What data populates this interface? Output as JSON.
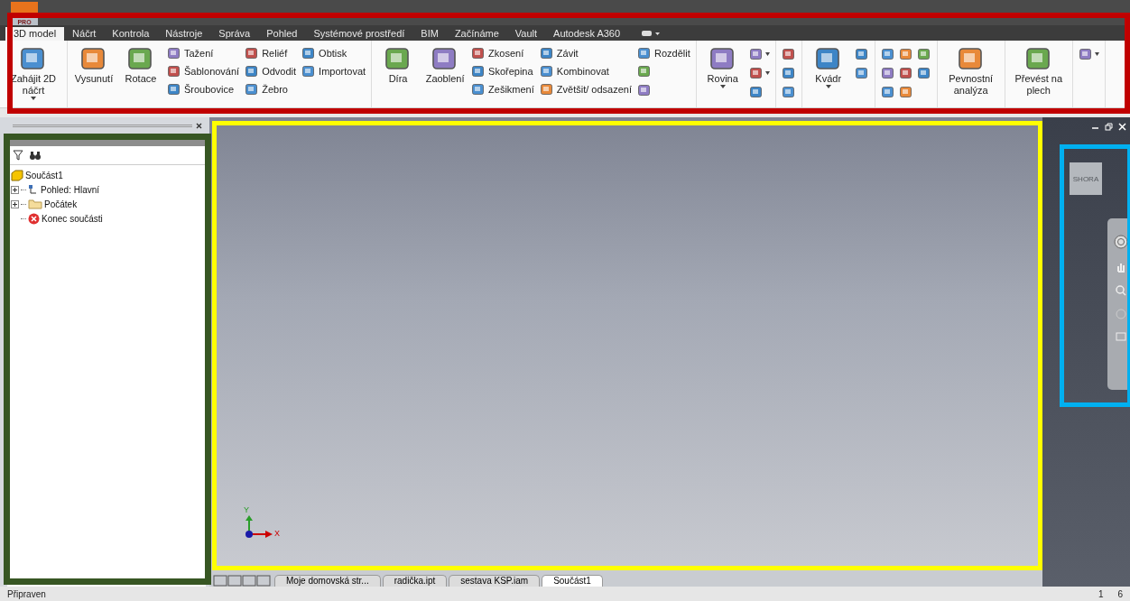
{
  "app": {
    "logo_badge": "PRO"
  },
  "ribbon_tabs": [
    {
      "label": "3D model",
      "selected": true
    },
    {
      "label": "Náčrt",
      "selected": false
    },
    {
      "label": "Kontrola",
      "selected": false
    },
    {
      "label": "Nástroje",
      "selected": false
    },
    {
      "label": "Správa",
      "selected": false
    },
    {
      "label": "Pohled",
      "selected": false
    },
    {
      "label": "Systémové prostředí",
      "selected": false
    },
    {
      "label": "BIM",
      "selected": false
    },
    {
      "label": "Začínáme",
      "selected": false
    },
    {
      "label": "Vault",
      "selected": false
    },
    {
      "label": "Autodesk A360",
      "selected": false
    }
  ],
  "ribbon_groups": [
    {
      "items": [
        {
          "kind": "large",
          "label": "Zahájit 2D náčrt",
          "dropdown": true
        }
      ]
    },
    {
      "items": [
        {
          "kind": "large",
          "label": "Vysunutí",
          "dropdown": false
        },
        {
          "kind": "large",
          "label": "Rotace",
          "dropdown": false
        },
        {
          "kind": "column",
          "buttons": [
            "Tažení",
            "Šablonování",
            "Šroubovice"
          ]
        },
        {
          "kind": "column",
          "buttons": [
            "Reliéf",
            "Odvodit",
            "Žebro"
          ]
        },
        {
          "kind": "column",
          "buttons": [
            "Obtisk",
            "Importovat"
          ]
        }
      ]
    },
    {
      "items": [
        {
          "kind": "large",
          "label": "Díra",
          "dropdown": false
        },
        {
          "kind": "large",
          "label": "Zaoblení",
          "dropdown": false
        },
        {
          "kind": "column",
          "buttons": [
            "Zkosení",
            "Skořepina",
            "Zešikmení"
          ]
        },
        {
          "kind": "column",
          "buttons": [
            "Závit",
            "Kombinovat",
            "Zvětšit/ odsazení"
          ]
        },
        {
          "kind": "column",
          "buttons": [
            "Rozdělit"
          ],
          "icons": [
            {
              "dropdown": false
            },
            {
              "dropdown": false
            }
          ]
        }
      ]
    },
    {
      "items": [
        {
          "kind": "large",
          "label": "Rovina",
          "dropdown": true
        },
        {
          "kind": "icon_column",
          "icons": [
            {
              "dropdown": true
            },
            {
              "dropdown": true
            },
            {
              "dropdown": false
            }
          ]
        }
      ]
    },
    {
      "items": [
        {
          "kind": "icon_column",
          "icons": [
            {
              "dropdown": false
            },
            {
              "dropdown": false
            },
            {
              "dropdown": false
            }
          ]
        }
      ]
    },
    {
      "items": [
        {
          "kind": "large",
          "label": "Kvádr",
          "dropdown": true
        },
        {
          "kind": "icon_column",
          "icons": [
            {
              "dropdown": false
            },
            {
              "dropdown": false
            }
          ]
        }
      ]
    },
    {
      "items": [
        {
          "kind": "icon_grid",
          "icons": [
            {
              "dropdown": false
            },
            {
              "dropdown": false
            },
            {
              "dropdown": false
            },
            {
              "dropdown": false
            },
            {
              "dropdown": false
            },
            {
              "dropdown": false
            },
            {
              "dropdown": false
            },
            {
              "dropdown": false
            }
          ]
        }
      ]
    },
    {
      "items": [
        {
          "kind": "large",
          "label": "Pevnostní analýza",
          "dropdown": false
        }
      ]
    },
    {
      "items": [
        {
          "kind": "large",
          "label": "Převést na plech",
          "dropdown": false
        }
      ]
    },
    {
      "items": [
        {
          "kind": "icon_column",
          "icons": [
            {
              "dropdown": true
            }
          ]
        }
      ]
    }
  ],
  "model_tree": [
    {
      "label": "Součást1",
      "kind": "part",
      "children": [
        {
          "label": "Pohled: Hlavní",
          "kind": "view",
          "expanded": false
        },
        {
          "label": "Počátek",
          "kind": "folder",
          "expanded": false
        },
        {
          "label": "Konec součásti",
          "kind": "end"
        }
      ]
    }
  ],
  "viewport": {
    "axis_y": "Y",
    "axis_x": "X",
    "view_cube": "SHORA"
  },
  "document_tabs": [
    {
      "label": "Moje domovská str...",
      "selected": false
    },
    {
      "label": "radička.ipt",
      "selected": false
    },
    {
      "label": "sestava KSP.iam",
      "selected": false
    },
    {
      "label": "Součást1",
      "selected": true
    }
  ],
  "status_bar": {
    "message": "Připraven",
    "count_1": "1",
    "count_2": "6"
  },
  "annotations": [
    {
      "kind": "ribbon",
      "color": "#c00000"
    },
    {
      "kind": "tree",
      "color": "#375623"
    },
    {
      "kind": "viewport",
      "color": "#ffff00"
    },
    {
      "kind": "navigation",
      "color": "#00b0f0"
    }
  ]
}
